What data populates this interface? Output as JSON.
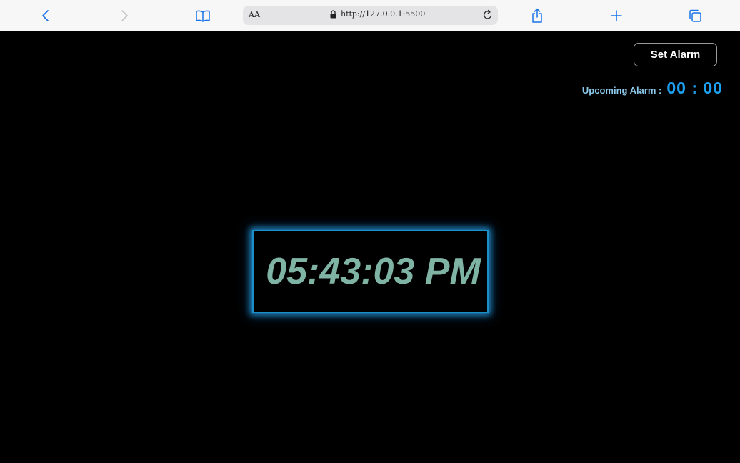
{
  "browser": {
    "aa_label": "AA",
    "url": "http://127.0.0.1:5500"
  },
  "alarm": {
    "set_button_label": "Set Alarm",
    "upcoming_label": "Upcoming Alarm :",
    "upcoming_time": "00 : 00"
  },
  "clock": {
    "time": "05:43:03 PM"
  },
  "colors": {
    "background": "#000000",
    "clock_text": "#7fb3a4",
    "clock_glow": "#1a8fc9",
    "upcoming_time": "#1ea0f0",
    "upcoming_label": "#8cc9ea",
    "browser_accent": "#1a73e8"
  }
}
